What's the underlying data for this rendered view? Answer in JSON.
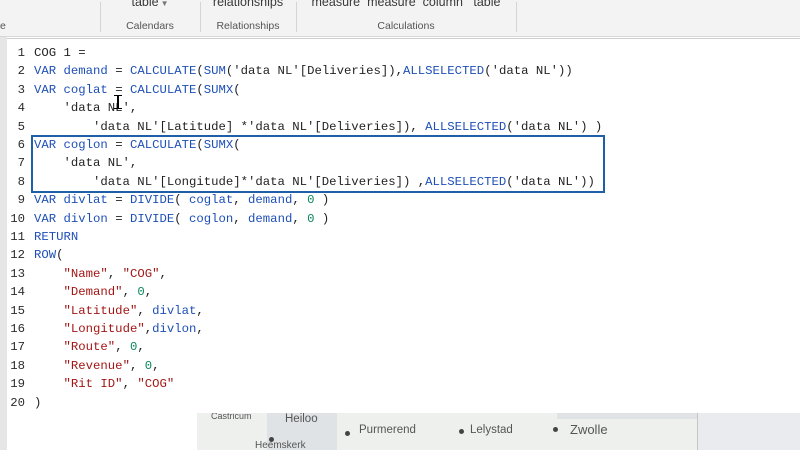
{
  "ribbon": {
    "left_cap": "e",
    "groups": [
      {
        "button": "table",
        "caption": "Calendars"
      },
      {
        "button": "relationships",
        "caption": "Relationships"
      },
      {
        "button": "measure  measure  column   table",
        "caption": "Calculations"
      }
    ]
  },
  "editor": {
    "lines": [
      {
        "num": "1",
        "tokens": [
          {
            "t": "COG 1 =",
            "c": ""
          }
        ]
      },
      {
        "num": "2",
        "tokens": [
          {
            "t": "VAR ",
            "c": "kw"
          },
          {
            "t": "demand",
            "c": "kw"
          },
          {
            "t": " = ",
            "c": ""
          },
          {
            "t": "CALCULATE",
            "c": "kw"
          },
          {
            "t": "(",
            "c": ""
          },
          {
            "t": "SUM",
            "c": "kw"
          },
          {
            "t": "('data NL'[Deliveries]),",
            "c": ""
          },
          {
            "t": "ALLSELECTED",
            "c": "kw"
          },
          {
            "t": "('data NL'))",
            "c": ""
          }
        ]
      },
      {
        "num": "3",
        "tokens": [
          {
            "t": "VAR ",
            "c": "kw"
          },
          {
            "t": "coglat",
            "c": "kw"
          },
          {
            "t": " = ",
            "c": ""
          },
          {
            "t": "CALCULATE",
            "c": "kw"
          },
          {
            "t": "(",
            "c": ""
          },
          {
            "t": "SUMX",
            "c": "kw"
          },
          {
            "t": "(",
            "c": ""
          }
        ]
      },
      {
        "num": "4",
        "tokens": [
          {
            "t": "    'data NL',",
            "c": ""
          }
        ]
      },
      {
        "num": "5",
        "tokens": [
          {
            "t": "        'data NL'[Latitude] *'data NL'[Deliveries]), ",
            "c": ""
          },
          {
            "t": "ALLSELECTED",
            "c": "kw"
          },
          {
            "t": "('data NL') )",
            "c": ""
          }
        ]
      },
      {
        "num": "6",
        "tokens": [
          {
            "t": "VAR ",
            "c": "kw"
          },
          {
            "t": "coglon",
            "c": "kw"
          },
          {
            "t": " = ",
            "c": ""
          },
          {
            "t": "CALCULATE",
            "c": "kw"
          },
          {
            "t": "(",
            "c": ""
          },
          {
            "t": "SUMX",
            "c": "kw"
          },
          {
            "t": "(",
            "c": ""
          }
        ]
      },
      {
        "num": "7",
        "tokens": [
          {
            "t": "    'data NL',",
            "c": ""
          }
        ]
      },
      {
        "num": "8",
        "tokens": [
          {
            "t": "        'data NL'[Longitude]*'data NL'[Deliveries]) ,",
            "c": ""
          },
          {
            "t": "ALLSELECTED",
            "c": "kw"
          },
          {
            "t": "('data NL'))",
            "c": ""
          }
        ]
      },
      {
        "num": "9",
        "tokens": [
          {
            "t": "VAR ",
            "c": "kw"
          },
          {
            "t": "divlat",
            "c": "kw"
          },
          {
            "t": " = ",
            "c": ""
          },
          {
            "t": "DIVIDE",
            "c": "kw"
          },
          {
            "t": "( ",
            "c": ""
          },
          {
            "t": "coglat",
            "c": "kw"
          },
          {
            "t": ", ",
            "c": ""
          },
          {
            "t": "demand",
            "c": "kw"
          },
          {
            "t": ", ",
            "c": ""
          },
          {
            "t": "0",
            "c": "num"
          },
          {
            "t": " )",
            "c": ""
          }
        ]
      },
      {
        "num": "10",
        "tokens": [
          {
            "t": "VAR ",
            "c": "kw"
          },
          {
            "t": "divlon",
            "c": "kw"
          },
          {
            "t": " = ",
            "c": ""
          },
          {
            "t": "DIVIDE",
            "c": "kw"
          },
          {
            "t": "( ",
            "c": ""
          },
          {
            "t": "coglon",
            "c": "kw"
          },
          {
            "t": ", ",
            "c": ""
          },
          {
            "t": "demand",
            "c": "kw"
          },
          {
            "t": ", ",
            "c": ""
          },
          {
            "t": "0",
            "c": "num"
          },
          {
            "t": " )",
            "c": ""
          }
        ]
      },
      {
        "num": "11",
        "tokens": [
          {
            "t": "RETURN",
            "c": "kw"
          }
        ]
      },
      {
        "num": "12",
        "tokens": [
          {
            "t": "ROW",
            "c": "kw"
          },
          {
            "t": "(",
            "c": ""
          }
        ]
      },
      {
        "num": "13",
        "tokens": [
          {
            "t": "    ",
            "c": ""
          },
          {
            "t": "\"Name\"",
            "c": "str"
          },
          {
            "t": ", ",
            "c": ""
          },
          {
            "t": "\"COG\"",
            "c": "str"
          },
          {
            "t": ",",
            "c": ""
          }
        ]
      },
      {
        "num": "14",
        "tokens": [
          {
            "t": "    ",
            "c": ""
          },
          {
            "t": "\"Demand\"",
            "c": "str"
          },
          {
            "t": ", ",
            "c": ""
          },
          {
            "t": "0",
            "c": "num"
          },
          {
            "t": ",",
            "c": ""
          }
        ]
      },
      {
        "num": "15",
        "tokens": [
          {
            "t": "    ",
            "c": ""
          },
          {
            "t": "\"Latitude\"",
            "c": "str"
          },
          {
            "t": ", ",
            "c": ""
          },
          {
            "t": "divlat",
            "c": "kw"
          },
          {
            "t": ",",
            "c": ""
          }
        ]
      },
      {
        "num": "16",
        "tokens": [
          {
            "t": "    ",
            "c": ""
          },
          {
            "t": "\"Longitude\"",
            "c": "str"
          },
          {
            "t": ",",
            "c": ""
          },
          {
            "t": "divlon",
            "c": "kw"
          },
          {
            "t": ",",
            "c": ""
          }
        ]
      },
      {
        "num": "17",
        "tokens": [
          {
            "t": "    ",
            "c": ""
          },
          {
            "t": "\"Route\"",
            "c": "str"
          },
          {
            "t": ", ",
            "c": ""
          },
          {
            "t": "0",
            "c": "num"
          },
          {
            "t": ",",
            "c": ""
          }
        ]
      },
      {
        "num": "18",
        "tokens": [
          {
            "t": "    ",
            "c": ""
          },
          {
            "t": "\"Revenue\"",
            "c": "str"
          },
          {
            "t": ", ",
            "c": ""
          },
          {
            "t": "0",
            "c": "num"
          },
          {
            "t": ",",
            "c": ""
          }
        ]
      },
      {
        "num": "19",
        "tokens": [
          {
            "t": "    ",
            "c": ""
          },
          {
            "t": "\"Rit ID\"",
            "c": "str"
          },
          {
            "t": ", ",
            "c": ""
          },
          {
            "t": "\"COG\"",
            "c": "str"
          }
        ]
      },
      {
        "num": "20",
        "tokens": [
          {
            "t": ")",
            "c": ""
          }
        ]
      }
    ],
    "highlight_color": "#1f5fa8"
  },
  "map": {
    "labels": [
      "Castricum",
      "Heiloo",
      "Purmerend",
      "Lelystad",
      "Zwolle",
      "Heemskerk"
    ]
  }
}
